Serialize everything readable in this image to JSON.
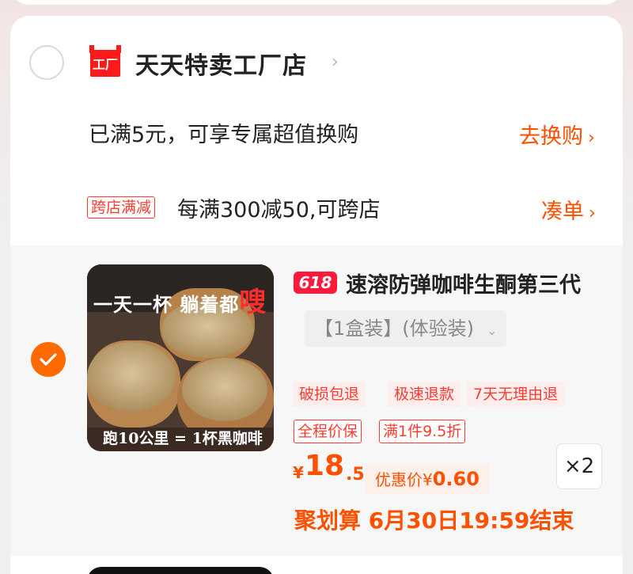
{
  "shop": {
    "name": "天天特卖工厂店",
    "logo_text": "工厂",
    "chevron": "›"
  },
  "promos": {
    "exchange_text": "已满5元，可享专属超值换购",
    "exchange_link": "去换购",
    "cross_store_badge": "跨店满减",
    "cross_store_text": "每满300减50,可跨店",
    "cross_store_link": "凑单",
    "link_chevron": "›"
  },
  "item": {
    "badge": "618",
    "title": "速溶防弹咖啡生酮第三代",
    "sku": "【1盒装】(体验装)",
    "sku_chevron": "⌄",
    "tags": [
      "破损包退",
      "极速退款",
      "7天无理由退"
    ],
    "tags_outlined": [
      "全程价保",
      "满1件9.5折"
    ],
    "price_symbol": "¥",
    "price_int": "18",
    "price_dec": ".5",
    "discount_label": "优惠价¥",
    "discount_value": "0.60",
    "quantity": "×2",
    "juhuasuan": "聚划算 6月30日19:59结束",
    "thumbnail": {
      "banner_pre": "一天一杯 躺着都",
      "banner_accent": "嗖",
      "caption": "跑10公里 = 1杯黑咖啡"
    }
  },
  "colors": {
    "accent": "#ff5000",
    "red": "#ff3b30",
    "check": "#ff6a00"
  }
}
